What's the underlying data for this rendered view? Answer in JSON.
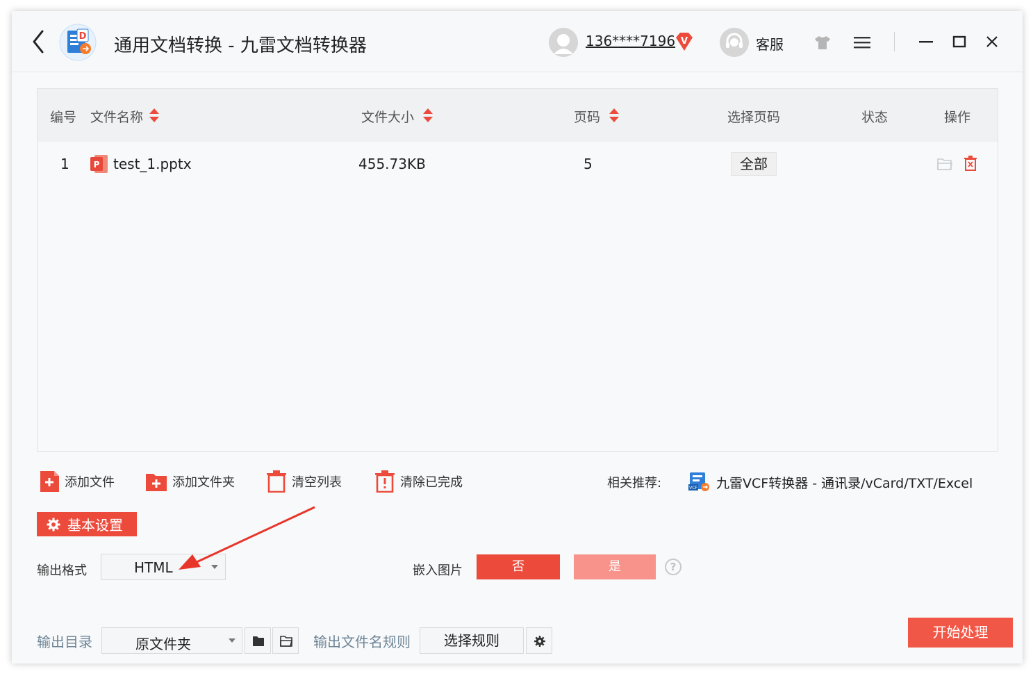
{
  "app": {
    "title": "通用文档转换 - 九雷文档转换器",
    "username": "136****7196",
    "vip_badge": "V",
    "service_label": "客服"
  },
  "table": {
    "headers": {
      "index": "编号",
      "filename": "文件名称",
      "size": "文件大小",
      "pages": "页码",
      "select_pages": "选择页码",
      "status": "状态",
      "actions": "操作"
    },
    "rows": [
      {
        "index": "1",
        "filename": "test_1.pptx",
        "file_icon_letter": "P",
        "size": "455.73KB",
        "pages": "5",
        "select_pages": "全部",
        "status": ""
      }
    ]
  },
  "toolbar": {
    "add_file": "添加文件",
    "add_folder": "添加文件夹",
    "clear_list": "清空列表",
    "clear_done": "清除已完成",
    "recommend_label": "相关推荐:",
    "recommend_link": "九雷VCF转换器 - 通讯录/vCard/TXT/Excel"
  },
  "settings": {
    "tab_label": "基本设置",
    "output_format_label": "输出格式",
    "output_format_value": "HTML",
    "embed_images_label": "嵌入图片",
    "embed_no": "否",
    "embed_yes": "是",
    "embed_selected": "否",
    "help": "?"
  },
  "output": {
    "dir_label": "输出目录",
    "dir_value": "原文件夹",
    "filename_rule_label": "输出文件名规则",
    "filename_rule_button": "选择规则",
    "start_button": "开始处理"
  },
  "colors": {
    "accent": "#ec4b3c",
    "accent_light": "#f7938a",
    "start_button": "#f15746",
    "muted_label": "#6e8597",
    "pptx_icon": "#e8473b"
  },
  "icons": {
    "back": "chevron-left-icon",
    "logo": "document-converter-logo",
    "vip": "vip-badge-icon",
    "skin": "tshirt-icon",
    "menu": "hamburger-menu-icon",
    "minimize": "minimize-icon",
    "maximize": "maximize-icon",
    "close": "close-icon",
    "sort": "sort-updown-icon",
    "open_folder": "open-folder-icon",
    "delete": "trash-icon",
    "gear": "gear-icon"
  }
}
